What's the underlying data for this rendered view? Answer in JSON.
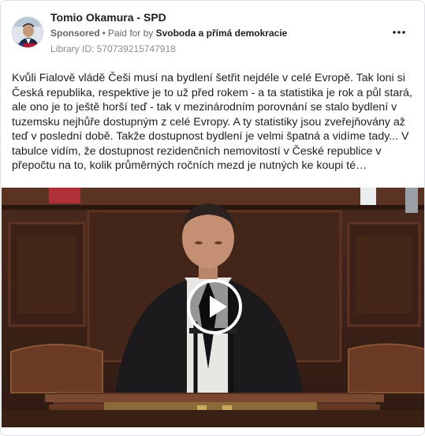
{
  "post": {
    "page_name": "Tomio Okamura - SPD",
    "sponsored_label": "Sponsored",
    "separator": "•",
    "paid_for_label": "Paid for by",
    "payer": "Svoboda a přímá demokracie",
    "library_id": "Library ID: 570739215747918",
    "more_icon": "more-horizontal-icon",
    "body": "Kvůli Fialově vládě Češi musí na bydlení šetřit nejdéle v celé Evropě. Tak loni si Česká republika, respektive je to už před rokem - a ta statistika je rok a půl stará, ale ono je to ještě horší teď - tak v mezinárodním porovnání se stalo bydlení v tuzemsku nejhůře dostupným z celé Evropy. A ty statistiky jsou zveřejňovány až teď v poslední době. Takže dostupnost bydlení je velmi špatná a vidíme tady... V tabulce vidím, že dostupnost rezidenčních nemovitostí v České republice v přepočtu na to, kolik průměrných ročních mezd je nutných ke koupi té nemovitosti..."
  },
  "video": {
    "play_icon": "play-icon"
  },
  "colors": {
    "text": "#1c1e21",
    "secondary": "#65676b",
    "muted": "#8a8d91",
    "border": "#dddfe2",
    "wood": "#5a3324"
  }
}
